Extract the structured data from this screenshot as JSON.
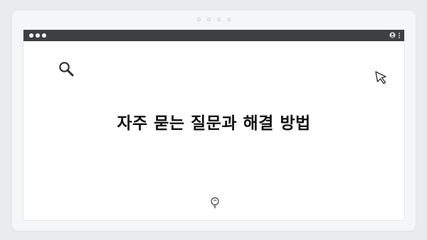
{
  "window": {
    "headline": "자주 묻는 질문과 해결 방법"
  },
  "icons": {
    "search": "search-icon",
    "cursor": "cursor-icon",
    "user": "user-icon",
    "menu": "kebab-menu-icon",
    "lightbulb": "lightbulb-icon"
  },
  "colors": {
    "titlebar": "#3e3f42",
    "background": "#e9ecef",
    "card": "#ffffff",
    "text": "#111111"
  }
}
